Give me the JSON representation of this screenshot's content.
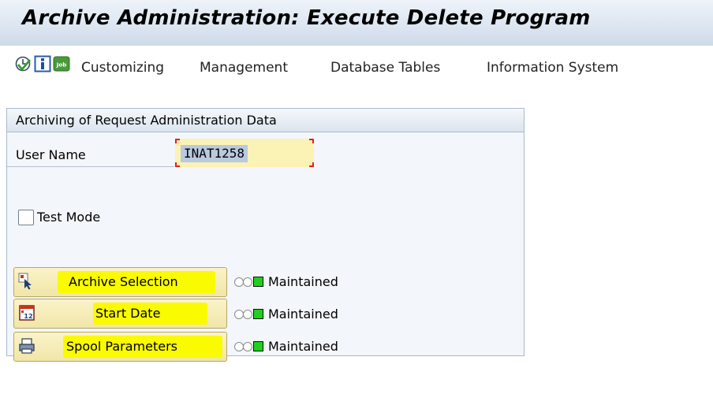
{
  "window": {
    "title": "Archive Administration: Execute Delete Program"
  },
  "toolbar": {
    "icons": [
      "execute-clock-icon",
      "info-icon",
      "job-icon"
    ],
    "job_icon_text": "Job",
    "menu": [
      "Customizing",
      "Management",
      "Database Tables",
      "Information System"
    ]
  },
  "group": {
    "title": "Archiving of Request Administration Data",
    "user_name_label": "User Name",
    "user_name_value": "INAT1258",
    "test_mode_label": "Test Mode",
    "test_mode_checked": false
  },
  "buttons": [
    {
      "label": "Archive Selection",
      "status": "Maintained",
      "icon": "selection-icon"
    },
    {
      "label": "Start Date",
      "status": "Maintained",
      "icon": "calendar-icon"
    },
    {
      "label": "Spool Parameters",
      "status": "Maintained",
      "icon": "printer-icon"
    }
  ],
  "colors": {
    "highlight": "#fafa00",
    "input_bg": "#fbf2b5",
    "status_green": "#20d020"
  }
}
